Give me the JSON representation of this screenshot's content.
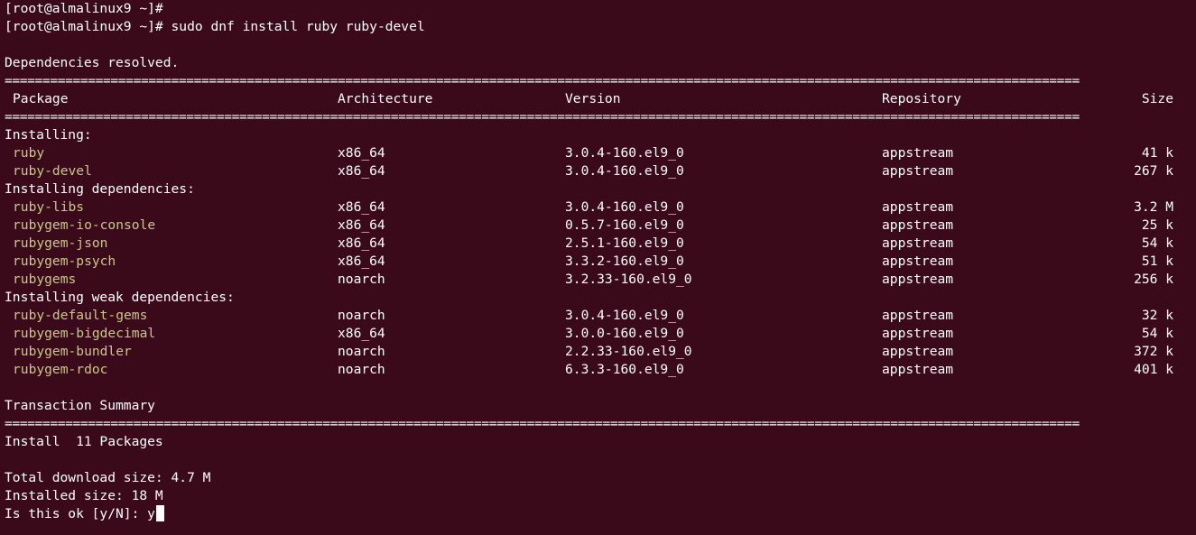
{
  "prompt1": "[root@almalinux9 ~]#",
  "prompt2": "[root@almalinux9 ~]# sudo dnf install ruby ruby-devel",
  "deps_resolved": "Dependencies resolved.",
  "separator": "==============================================================================================================================================",
  "headers": {
    "package": "Package",
    "architecture": "Architecture",
    "version": "Version",
    "repository": "Repository",
    "size": "Size"
  },
  "groups": [
    {
      "title": "Installing:",
      "packages": [
        {
          "name": "ruby",
          "arch": "x86_64",
          "version": "3.0.4-160.el9_0",
          "repo": "appstream",
          "size": "41 k"
        },
        {
          "name": "ruby-devel",
          "arch": "x86_64",
          "version": "3.0.4-160.el9_0",
          "repo": "appstream",
          "size": "267 k"
        }
      ]
    },
    {
      "title": "Installing dependencies:",
      "packages": [
        {
          "name": "ruby-libs",
          "arch": "x86_64",
          "version": "3.0.4-160.el9_0",
          "repo": "appstream",
          "size": "3.2 M"
        },
        {
          "name": "rubygem-io-console",
          "arch": "x86_64",
          "version": "0.5.7-160.el9_0",
          "repo": "appstream",
          "size": "25 k"
        },
        {
          "name": "rubygem-json",
          "arch": "x86_64",
          "version": "2.5.1-160.el9_0",
          "repo": "appstream",
          "size": "54 k"
        },
        {
          "name": "rubygem-psych",
          "arch": "x86_64",
          "version": "3.3.2-160.el9_0",
          "repo": "appstream",
          "size": "51 k"
        },
        {
          "name": "rubygems",
          "arch": "noarch",
          "version": "3.2.33-160.el9_0",
          "repo": "appstream",
          "size": "256 k"
        }
      ]
    },
    {
      "title": "Installing weak dependencies:",
      "packages": [
        {
          "name": "ruby-default-gems",
          "arch": "noarch",
          "version": "3.0.4-160.el9_0",
          "repo": "appstream",
          "size": "32 k"
        },
        {
          "name": "rubygem-bigdecimal",
          "arch": "x86_64",
          "version": "3.0.0-160.el9_0",
          "repo": "appstream",
          "size": "54 k"
        },
        {
          "name": "rubygem-bundler",
          "arch": "noarch",
          "version": "2.2.33-160.el9_0",
          "repo": "appstream",
          "size": "372 k"
        },
        {
          "name": "rubygem-rdoc",
          "arch": "noarch",
          "version": "6.3.3-160.el9_0",
          "repo": "appstream",
          "size": "401 k"
        }
      ]
    }
  ],
  "transaction_summary": "Transaction Summary",
  "install_summary": "Install  11 Packages",
  "total_download": "Total download size: 4.7 M",
  "installed_size": "Installed size: 18 M",
  "confirm_prompt": "Is this ok [y/N]: ",
  "input_value": "y"
}
